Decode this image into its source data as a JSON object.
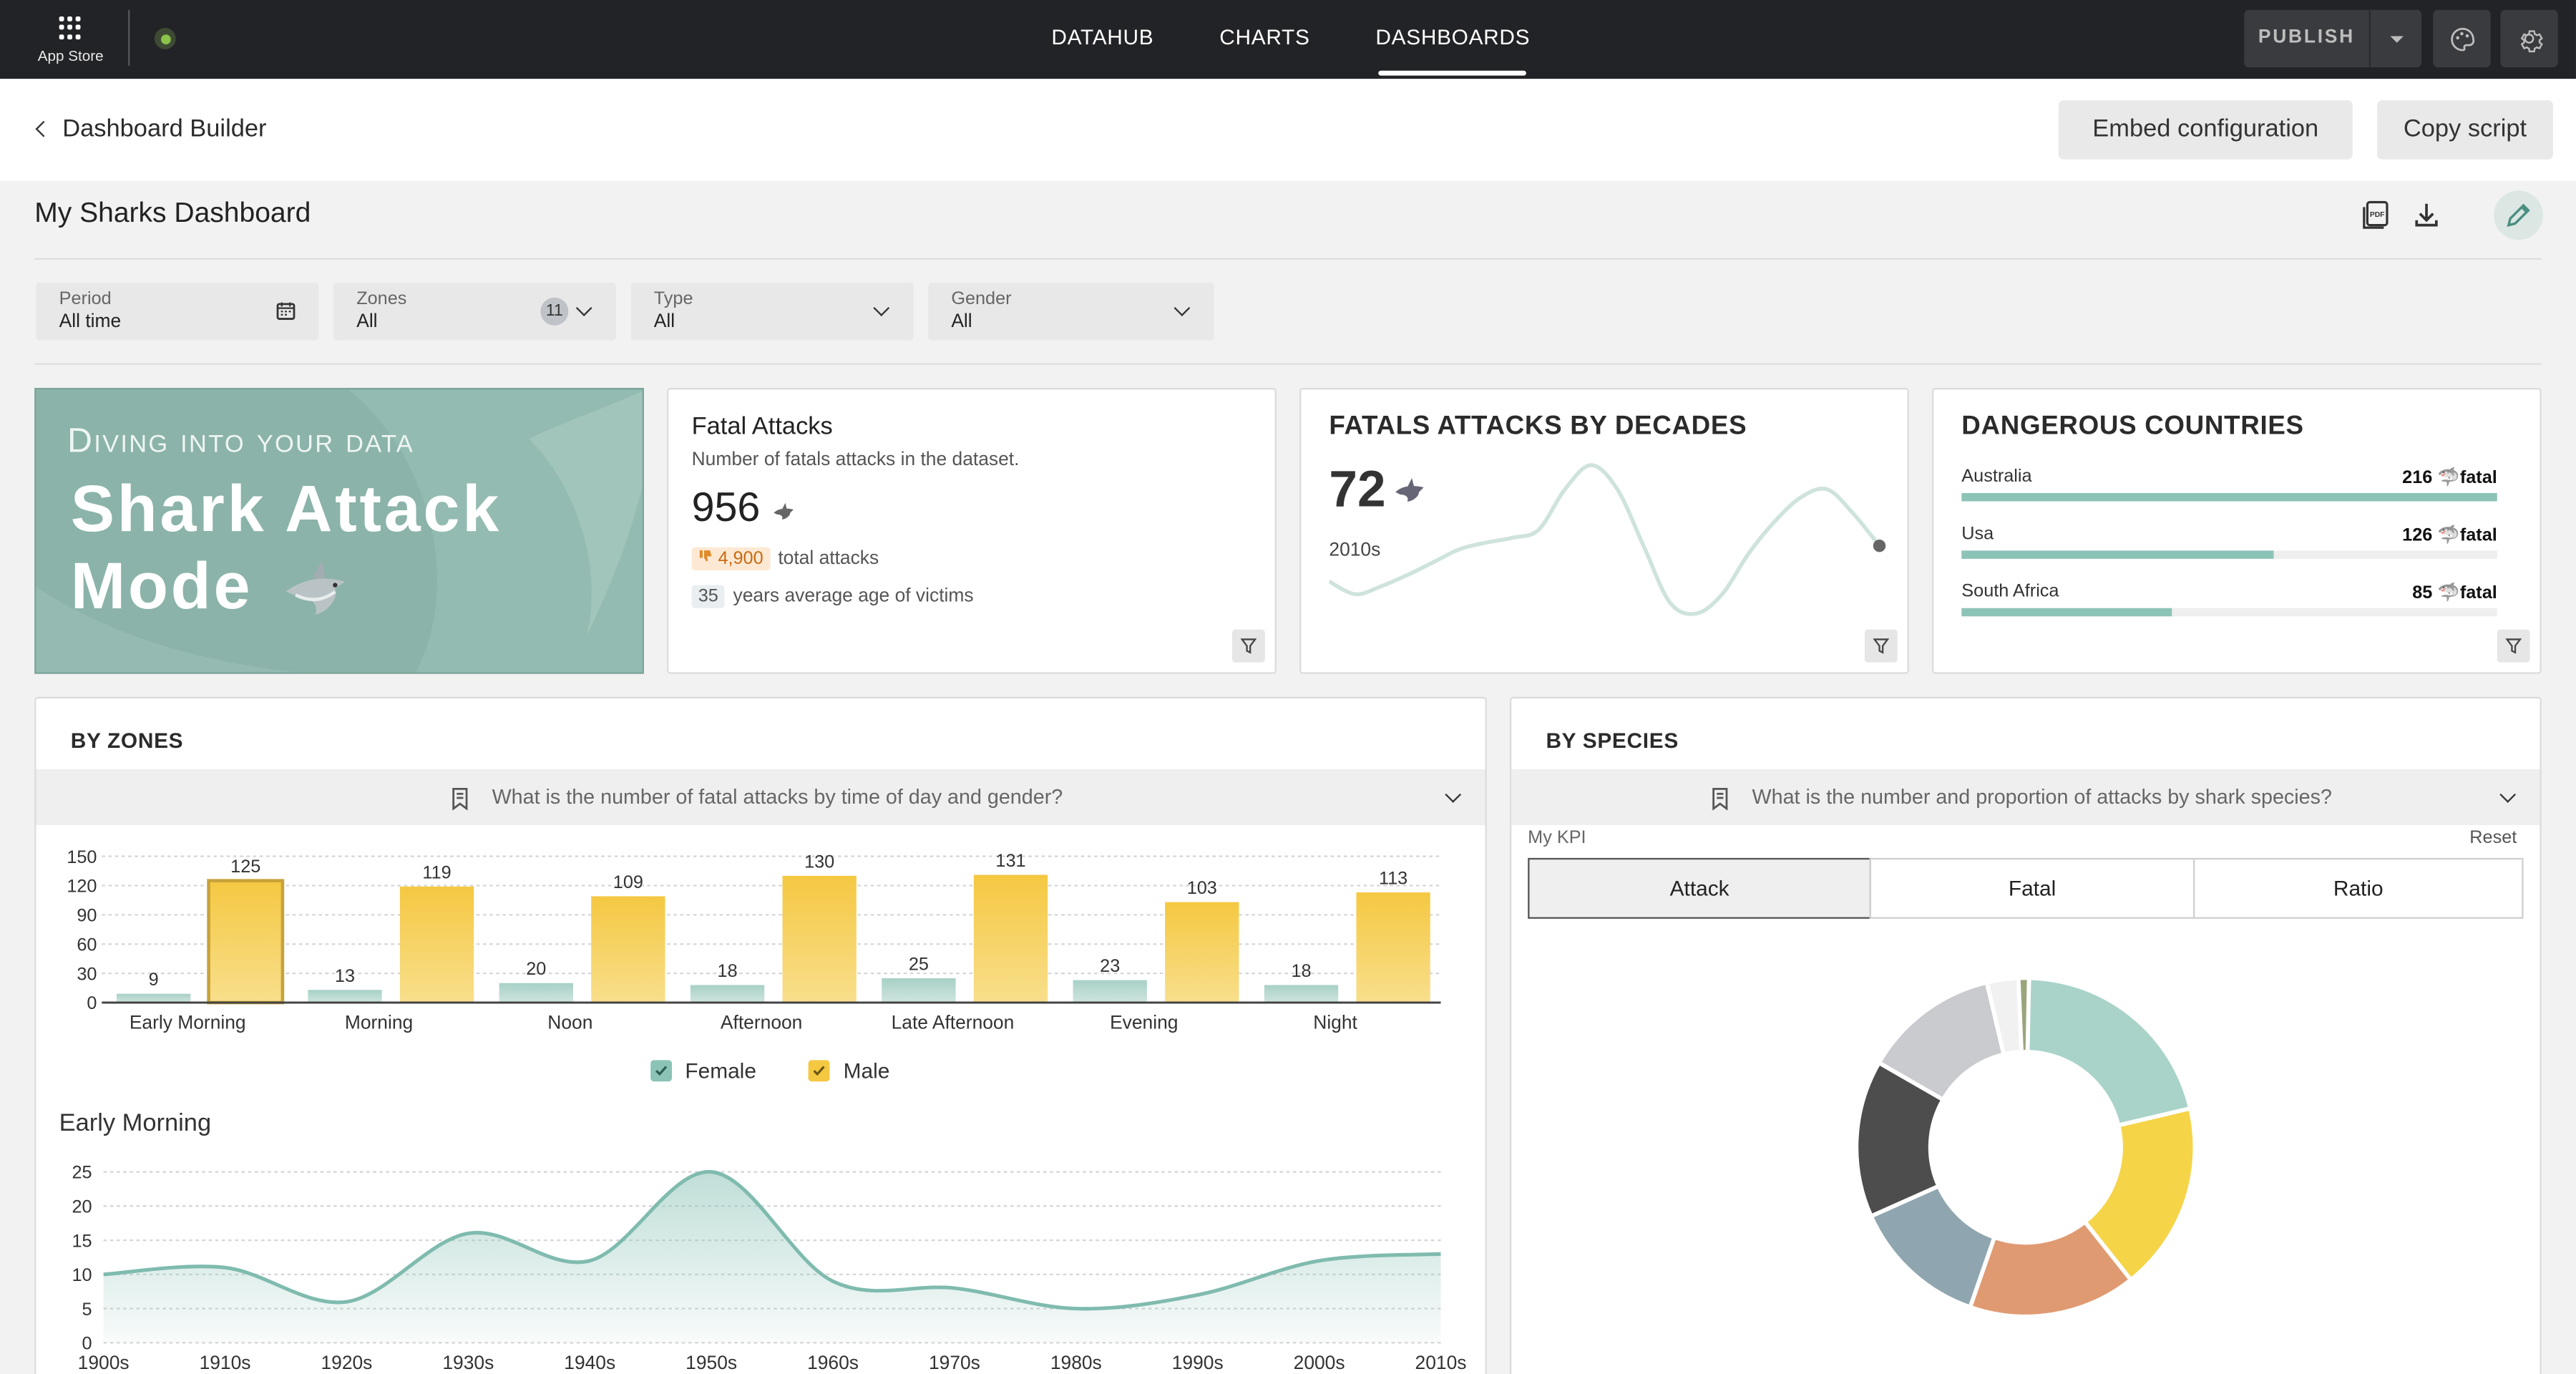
{
  "topbar": {
    "app_store_label": "App Store",
    "nav": [
      "DATAHUB",
      "CHARTS",
      "DASHBOARDS"
    ],
    "active_nav": "DASHBOARDS",
    "publish_label": "PUBLISH"
  },
  "subheader": {
    "back_label": "Dashboard Builder",
    "embed_label": "Embed configuration",
    "copy_label": "Copy script"
  },
  "dashboard": {
    "title": "My Sharks Dashboard"
  },
  "filters": [
    {
      "label": "Period",
      "value": "All time"
    },
    {
      "label": "Zones",
      "value": "All",
      "badge": "11"
    },
    {
      "label": "Type",
      "value": "All"
    },
    {
      "label": "Gender",
      "value": "All"
    }
  ],
  "hero": {
    "kicker": "Diving into your data",
    "title_line1": "Shark Attack",
    "title_line2": "Mode"
  },
  "fatal_card": {
    "title": "Fatal Attacks",
    "subtitle": "Number of fatals attacks in the dataset.",
    "value": "956",
    "total_tag": "4,900",
    "total_label": "total attacks",
    "age_tag": "35",
    "age_label": "years average age of victims"
  },
  "decades_card": {
    "title": "FATALS ATTACKS BY DECADES",
    "value": "72",
    "decade": "2010s"
  },
  "countries_card": {
    "title": "DANGEROUS COUNTRIES",
    "unit": "fatal",
    "items": [
      {
        "name": "Australia",
        "value": "216",
        "fraction": 1.0
      },
      {
        "name": "Usa",
        "value": "126",
        "fraction": 0.583
      },
      {
        "name": "South Africa",
        "value": "85",
        "fraction": 0.394
      }
    ]
  },
  "zones_panel": {
    "title": "BY ZONES",
    "question": "What is the number of fatal attacks by time of day and gender?",
    "legend": [
      "Female",
      "Male"
    ],
    "sub_chart_title": "Early Morning"
  },
  "species_panel": {
    "title": "BY SPECIES",
    "question": "What is the number and proportion of attacks by shark species?",
    "kpi_label": "My KPI",
    "reset_label": "Reset",
    "segments": [
      "Attack",
      "Fatal",
      "Ratio"
    ],
    "active_segment": "Attack"
  },
  "colors": {
    "female": "#8cc3b7",
    "male": "#f5c842",
    "topbar": "#222326",
    "hero": "#8bb3a9"
  },
  "chart_data": [
    {
      "type": "bar",
      "categories": [
        "Early Morning",
        "Morning",
        "Noon",
        "Afternoon",
        "Late Afternoon",
        "Evening",
        "Night"
      ],
      "series": [
        {
          "name": "Female",
          "values": [
            9,
            13,
            20,
            18,
            25,
            23,
            18
          ]
        },
        {
          "name": "Male",
          "values": [
            125,
            119,
            109,
            130,
            131,
            103,
            113
          ]
        }
      ],
      "yticks": [
        0,
        30,
        60,
        90,
        120,
        150
      ],
      "ylim": [
        0,
        150
      ],
      "legend": "bottom-center",
      "grid": true
    },
    {
      "type": "area",
      "x": [
        "1900s",
        "1910s",
        "1920s",
        "1930s",
        "1940s",
        "1950s",
        "1960s",
        "1970s",
        "1980s",
        "1990s",
        "2000s",
        "2010s"
      ],
      "values": [
        10,
        11,
        6,
        16,
        12,
        25,
        9,
        8,
        5,
        7,
        12,
        13
      ],
      "yticks": [
        0,
        5,
        10,
        15,
        20,
        25
      ],
      "ylim": [
        0,
        25
      ],
      "grid": true
    },
    {
      "type": "line",
      "values": [
        38,
        30,
        35,
        42,
        50,
        58,
        62,
        65,
        70,
        95,
        110,
        95,
        60,
        25,
        18,
        30,
        55,
        75,
        90,
        95,
        80,
        60
      ],
      "highlight": "2010s"
    },
    {
      "type": "pie",
      "donut": true,
      "values": [
        21,
        18,
        16,
        13,
        15,
        13,
        3,
        1
      ],
      "colors": [
        "#a9d3c9",
        "#f5d447",
        "#e09a72",
        "#8fa6b0",
        "#4d4d4d",
        "#c9cbcf",
        "#f1f1f1",
        "#9aa57c"
      ]
    }
  ]
}
